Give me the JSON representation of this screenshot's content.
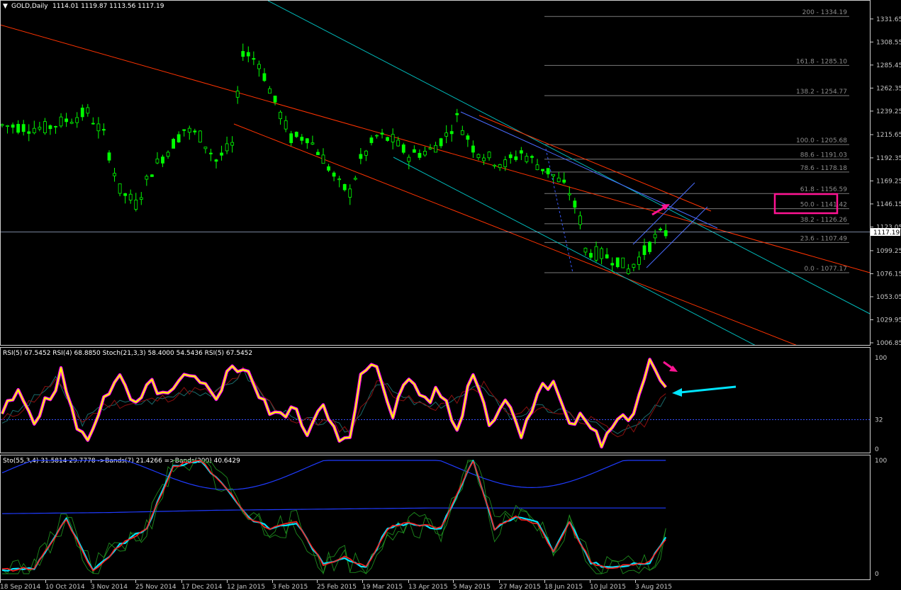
{
  "header": {
    "symbol": "GOLD,Daily",
    "ohlc": "1114.01 1119.87 1113.56 1117.19"
  },
  "panels": {
    "rsi_label": "RSI(5) 67.5452  RSI(4) 68.8850  Stoch(21,3,3) 58.4000 54.5436  RSI(5) 67.5452",
    "sto_label": "Sto(55,3,4) 31.5814 29.7778  ->Bands(7) 21.4266  =>Bands(200) 40.6429"
  },
  "colors": {
    "background": "#000000",
    "candle": "#00ff00",
    "redline": "#ff3300",
    "cyanline": "#00c8c8",
    "fib": "#7a7a7a",
    "highlight": "#ff1493",
    "rsi_main": "#ffff00",
    "rsi_shadow": "#ff00ff",
    "sto_main": "#00e5ff",
    "sto_signal": "#ff2020",
    "band": "#1f3bff"
  },
  "chart_data": [
    {
      "type": "candlestick",
      "title": "GOLD,Daily",
      "current_price": "1117.19",
      "ylim": [
        1006.85,
        1345
      ],
      "y_ticks": [
        "1331.65",
        "1308.55",
        "1285.45",
        "1262.35",
        "1239.25",
        "1215.65",
        "1192.35",
        "1169.25",
        "1146.15",
        "1123.05",
        "1099.25",
        "1076.15",
        "1053.05",
        "1029.95",
        "1006.85"
      ],
      "x_ticks": [
        "18 Sep 2014",
        "10 Oct 2014",
        "3 Nov 2014",
        "25 Nov 2014",
        "17 Dec 2014",
        "12 Jan 2015",
        "3 Feb 2015",
        "25 Feb 2015",
        "19 Mar 2015",
        "13 Apr 2015",
        "5 May 2015",
        "27 May 2015",
        "18 Jun 2015",
        "10 Jul 2015",
        "3 Aug 2015"
      ],
      "fibonacci": [
        {
          "label": "200 - 1334.19",
          "price": 1334.19
        },
        {
          "label": "161.8 - 1285.10",
          "price": 1285.1
        },
        {
          "label": "138.2 - 1254.77",
          "price": 1254.77
        },
        {
          "label": "100.0 - 1205.68",
          "price": 1205.68
        },
        {
          "label": "88.6 - 1191.03",
          "price": 1191.03
        },
        {
          "label": "78.6 - 1178.18",
          "price": 1178.18
        },
        {
          "label": "61.8 - 1156.59",
          "price": 1156.59
        },
        {
          "label": "50.0 - 1141.42",
          "price": 1141.42,
          "highlighted": true
        },
        {
          "label": "38.2 - 1126.26",
          "price": 1126.26
        },
        {
          "label": "23.6 - 1107.49",
          "price": 1107.49
        },
        {
          "label": "0.0 - 1077.17",
          "price": 1077.17
        }
      ],
      "price_path": [
        [
          0,
          1225
        ],
        [
          8,
          1222
        ],
        [
          16,
          1238
        ],
        [
          19,
          1215
        ],
        [
          22,
          1160
        ],
        [
          25,
          1146
        ],
        [
          28,
          1180
        ],
        [
          31,
          1200
        ],
        [
          34,
          1221
        ],
        [
          37,
          1214
        ],
        [
          40,
          1190
        ],
        [
          43,
          1205
        ],
        [
          45,
          1300
        ],
        [
          48,
          1288
        ],
        [
          51,
          1248
        ],
        [
          54,
          1212
        ],
        [
          57,
          1214
        ],
        [
          60,
          1192
        ],
        [
          63,
          1165
        ],
        [
          65,
          1158
        ],
        [
          67,
          1190
        ],
        [
          70,
          1214
        ],
        [
          73,
          1210
        ],
        [
          76,
          1195
        ],
        [
          80,
          1200
        ],
        [
          83,
          1215
        ],
        [
          85,
          1232
        ],
        [
          88,
          1203
        ],
        [
          91,
          1192
        ],
        [
          94,
          1186
        ],
        [
          97,
          1198
        ],
        [
          100,
          1186
        ],
        [
          103,
          1175
        ],
        [
          106,
          1158
        ],
        [
          108,
          1130
        ],
        [
          109,
          1100
        ],
        [
          112,
          1095
        ],
        [
          115,
          1090
        ],
        [
          117,
          1080
        ],
        [
          120,
          1098
        ],
        [
          122,
          1112
        ],
        [
          124,
          1117
        ]
      ]
    },
    {
      "type": "line",
      "title": "RSI(5) 67.5452  RSI(4) 68.8850  Stoch(21,3,3) 58.4000 54.5436",
      "ylim": [
        0,
        100
      ],
      "y_ticks": [
        "100",
        "32",
        "0"
      ],
      "level": 32,
      "series": [
        {
          "name": "RSI(5)",
          "values": [
            [
              0,
              40
            ],
            [
              3,
              60
            ],
            [
              6,
              35
            ],
            [
              9,
              55
            ],
            [
              11,
              85
            ],
            [
              13,
              40
            ],
            [
              16,
              5
            ],
            [
              19,
              60
            ],
            [
              22,
              75
            ],
            [
              25,
              45
            ],
            [
              28,
              72
            ],
            [
              31,
              55
            ],
            [
              34,
              78
            ],
            [
              37,
              70
            ],
            [
              40,
              60
            ],
            [
              43,
              90
            ],
            [
              46,
              88
            ],
            [
              48,
              55
            ],
            [
              51,
              35
            ],
            [
              54,
              45
            ],
            [
              57,
              20
            ],
            [
              60,
              55
            ],
            [
              63,
              5
            ],
            [
              65,
              10
            ],
            [
              67,
              78
            ],
            [
              70,
              92
            ],
            [
              73,
              40
            ],
            [
              76,
              78
            ],
            [
              79,
              55
            ],
            [
              82,
              62
            ],
            [
              85,
              20
            ],
            [
              88,
              88
            ],
            [
              91,
              30
            ],
            [
              94,
              55
            ],
            [
              97,
              20
            ],
            [
              100,
              60
            ],
            [
              103,
              78
            ],
            [
              106,
              25
            ],
            [
              109,
              35
            ],
            [
              112,
              5
            ],
            [
              115,
              35
            ],
            [
              118,
              35
            ],
            [
              121,
              92
            ],
            [
              124,
              72
            ]
          ]
        },
        {
          "name": "Stoch(21,3,3)",
          "values": [
            [
              0,
              30
            ],
            [
              5,
              50
            ],
            [
              10,
              75
            ],
            [
              15,
              30
            ],
            [
              20,
              50
            ],
            [
              25,
              50
            ],
            [
              30,
              55
            ],
            [
              35,
              65
            ],
            [
              40,
              60
            ],
            [
              45,
              85
            ],
            [
              50,
              50
            ],
            [
              55,
              30
            ],
            [
              60,
              30
            ],
            [
              65,
              20
            ],
            [
              70,
              75
            ],
            [
              75,
              55
            ],
            [
              80,
              45
            ],
            [
              85,
              55
            ],
            [
              90,
              70
            ],
            [
              95,
              35
            ],
            [
              100,
              45
            ],
            [
              105,
              40
            ],
            [
              110,
              30
            ],
            [
              115,
              15
            ],
            [
              120,
              30
            ],
            [
              124,
              58
            ]
          ]
        }
      ]
    },
    {
      "type": "line",
      "title": "Sto(55,3,4) 31.5814 29.7778",
      "ylim": [
        0,
        100
      ],
      "y_ticks": [
        "100",
        "0"
      ],
      "series": [
        {
          "name": "Sto(55,3,4)",
          "values": [
            [
              0,
              3
            ],
            [
              6,
              5
            ],
            [
              12,
              48
            ],
            [
              17,
              2
            ],
            [
              22,
              25
            ],
            [
              27,
              40
            ],
            [
              32,
              95
            ],
            [
              37,
              100
            ],
            [
              42,
              75
            ],
            [
              46,
              50
            ],
            [
              50,
              40
            ],
            [
              55,
              45
            ],
            [
              60,
              8
            ],
            [
              64,
              15
            ],
            [
              68,
              5
            ],
            [
              72,
              40
            ],
            [
              76,
              45
            ],
            [
              82,
              40
            ],
            [
              88,
              100
            ],
            [
              92,
              40
            ],
            [
              96,
              50
            ],
            [
              100,
              45
            ],
            [
              103,
              20
            ],
            [
              106,
              45
            ],
            [
              110,
              10
            ],
            [
              114,
              5
            ],
            [
              118,
              8
            ],
            [
              121,
              10
            ],
            [
              124,
              31
            ]
          ]
        },
        {
          "name": "Bands(200)",
          "values": [
            [
              0,
              53
            ],
            [
              20,
              54
            ],
            [
              40,
              56
            ],
            [
              60,
              57
            ],
            [
              80,
              58
            ],
            [
              100,
              58
            ],
            [
              124,
              58
            ]
          ]
        }
      ]
    }
  ]
}
